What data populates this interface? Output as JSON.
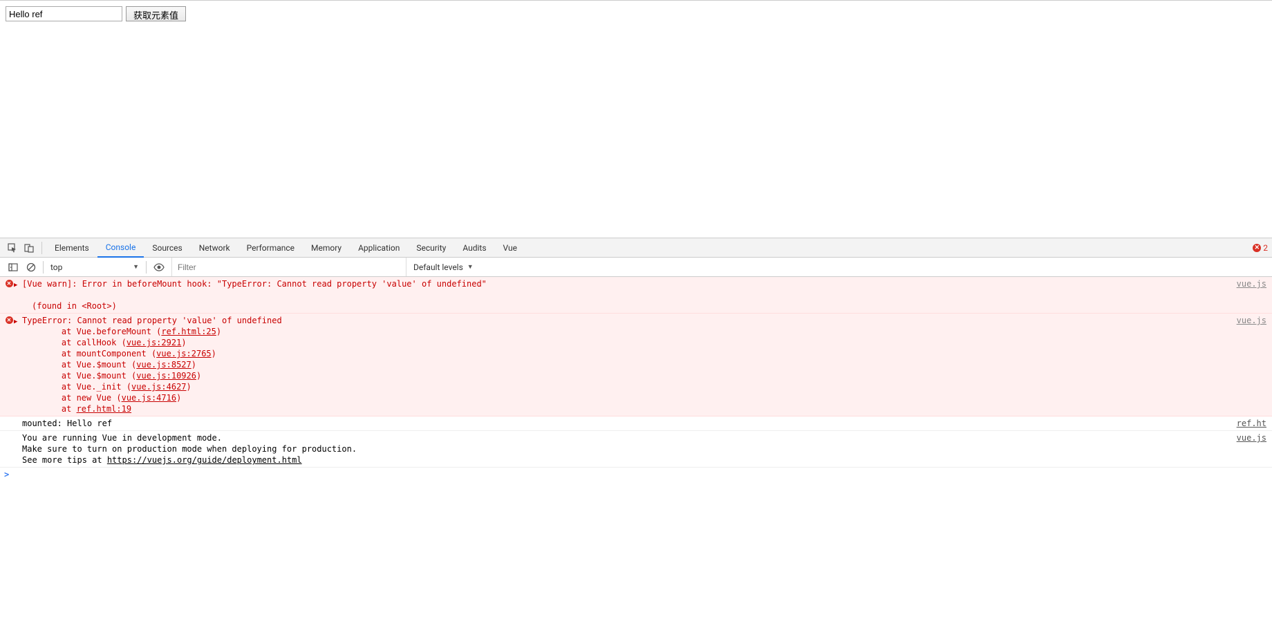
{
  "page": {
    "input_value": "Hello ref",
    "button_label": "获取元素值"
  },
  "devtools": {
    "tabs": [
      "Elements",
      "Console",
      "Sources",
      "Network",
      "Performance",
      "Memory",
      "Application",
      "Security",
      "Audits",
      "Vue"
    ],
    "active_tab": "Console",
    "error_count": "2",
    "toolbar": {
      "context": "top",
      "filter_placeholder": "Filter",
      "levels_label": "Default levels"
    },
    "logs": {
      "warn1": {
        "text": "[Vue warn]: Error in beforeMount hook: \"TypeError: Cannot read property 'value' of undefined\"",
        "found_in": "(found in <Root>)",
        "source": "vue.js"
      },
      "err1": {
        "head": "TypeError: Cannot read property 'value' of undefined",
        "stack": [
          {
            "pre": "    at Vue.beforeMount (",
            "link": "ref.html:25",
            "post": ")"
          },
          {
            "pre": "    at callHook (",
            "link": "vue.js:2921",
            "post": ")"
          },
          {
            "pre": "    at mountComponent (",
            "link": "vue.js:2765",
            "post": ")"
          },
          {
            "pre": "    at Vue.$mount (",
            "link": "vue.js:8527",
            "post": ")"
          },
          {
            "pre": "    at Vue.$mount (",
            "link": "vue.js:10926",
            "post": ")"
          },
          {
            "pre": "    at Vue._init (",
            "link": "vue.js:4627",
            "post": ")"
          },
          {
            "pre": "    at new Vue (",
            "link": "vue.js:4716",
            "post": ")"
          },
          {
            "pre": "    at ",
            "link": "ref.html:19",
            "post": ""
          }
        ],
        "source": "vue.js"
      },
      "info1": {
        "text": "mounted: Hello ref",
        "source": "ref.ht"
      },
      "info2": {
        "line1": "You are running Vue in development mode.",
        "line2": "Make sure to turn on production mode when deploying for production.",
        "line3_pre": "See more tips at ",
        "line3_link": "https://vuejs.org/guide/deployment.html",
        "source": "vue.js"
      }
    },
    "prompt": ">"
  }
}
